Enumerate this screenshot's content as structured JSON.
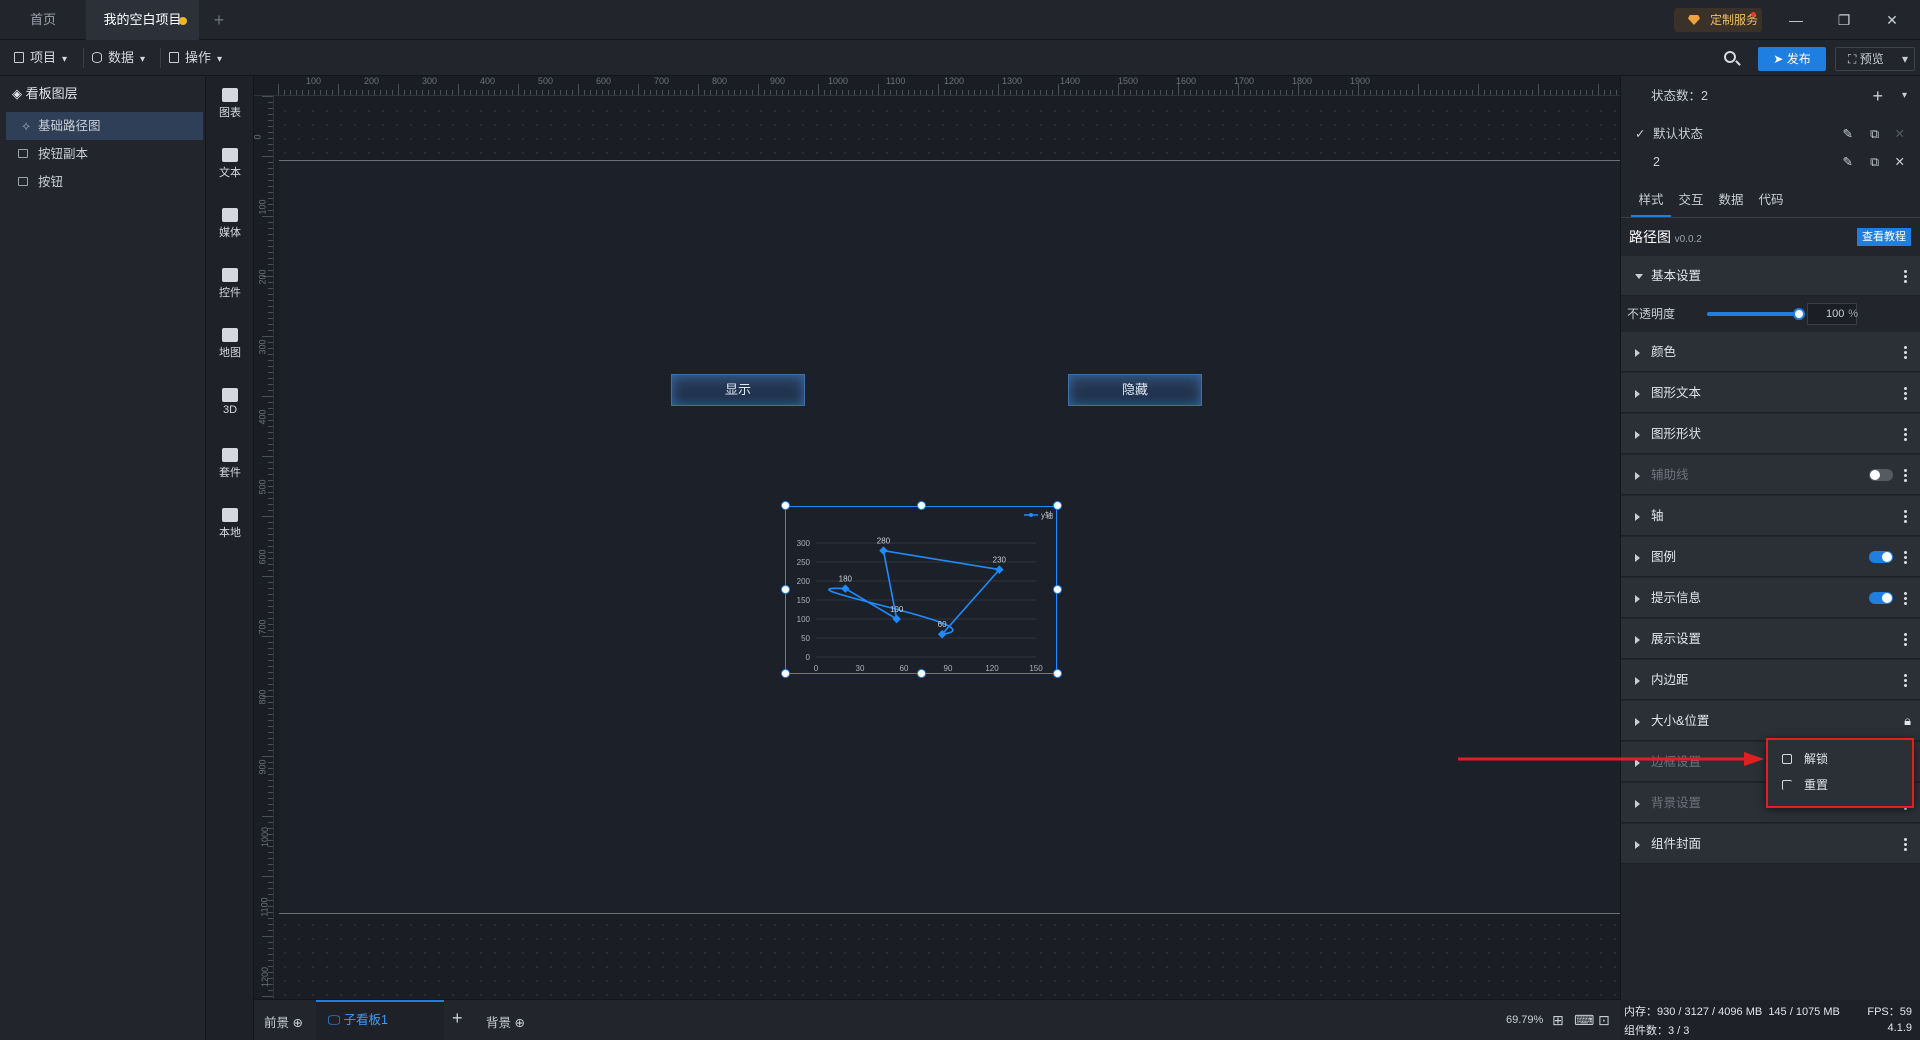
{
  "tabs": {
    "home": "首页",
    "project": "我的空白项目",
    "add": "+"
  },
  "titlebar": {
    "service": "定制服务"
  },
  "toolbar": {
    "project": "项目",
    "data": "数据",
    "operate": "操作",
    "publish": "发布",
    "preview": "预览"
  },
  "layers": {
    "title": "看板图层",
    "items": [
      "基础路径图",
      "按钮副本",
      "按钮"
    ]
  },
  "components": [
    "图表",
    "文本",
    "媒体",
    "控件",
    "地图",
    "3D",
    "套件",
    "本地"
  ],
  "ruler": {
    "h": [
      "100",
      "200",
      "300",
      "400",
      "500",
      "600",
      "700",
      "800",
      "900",
      "1000",
      "1100",
      "1200",
      "1300",
      "1400",
      "1500",
      "1600",
      "1700",
      "1800",
      "1900"
    ],
    "v": [
      "0",
      "100",
      "200",
      "300",
      "400",
      "500",
      "600",
      "700",
      "800",
      "900",
      "1000",
      "1100",
      "1200"
    ]
  },
  "canvas": {
    "show_btn": "显示",
    "hide_btn": "隐藏"
  },
  "chart_data": {
    "type": "line",
    "legend": "y轴",
    "x": [
      55,
      46,
      125,
      86,
      20
    ],
    "y": [
      100,
      280,
      230,
      60,
      180
    ],
    "labels": [
      "100",
      "280",
      "230",
      "60",
      "180"
    ],
    "xticks": [
      "0",
      "30",
      "60",
      "90",
      "120",
      "150"
    ],
    "yticks": [
      "0",
      "50",
      "100",
      "150",
      "200",
      "250",
      "300"
    ],
    "xlim": [
      0,
      150
    ],
    "ylim": [
      0,
      300
    ],
    "color": "#1e8cff"
  },
  "bottombar": {
    "front": "前景",
    "sub": "子看板1",
    "add": "+",
    "bg": "背景",
    "zoom": "69.79%"
  },
  "right": {
    "state_count": "状态数：2",
    "states": [
      "默认状态",
      "2"
    ],
    "tabs": [
      "样式",
      "交互",
      "数据",
      "代码"
    ],
    "comp_name": "路径图",
    "version": "v0.0.2",
    "tutorial": "查看教程",
    "basic": "基本设置",
    "opacity_label": "不透明度",
    "opacity_value": "100",
    "opacity_unit": "%",
    "opacity": 1.0,
    "sections": [
      "颜色",
      "图形文本",
      "图形形状",
      "辅助线",
      "轴",
      "图例",
      "提示信息",
      "展示设置",
      "内边距",
      "大小&位置",
      "边框设置",
      "背景设置",
      "组件封面"
    ]
  },
  "popup": {
    "unlock": "解锁",
    "reset": "重置"
  },
  "status": {
    "mem_label": "内存：",
    "mem": "930 / 3127 / 4096 MB",
    "mem2": "145 / 1075 MB",
    "fps": "FPS：59",
    "count": "组件数：3 / 3",
    "ver": "4.1.9"
  },
  "colors": {
    "accent": "#1e7fe0",
    "highlight": "#e02020"
  }
}
